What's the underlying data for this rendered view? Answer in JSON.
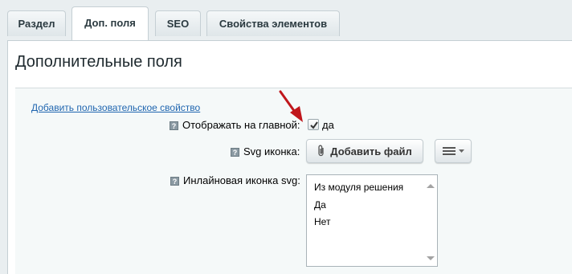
{
  "tabs": [
    {
      "label": "Раздел"
    },
    {
      "label": "Доп. поля"
    },
    {
      "label": "SEO"
    },
    {
      "label": "Свойства элементов"
    }
  ],
  "section_title": "Дополнительные поля",
  "add_property_link": "Добавить пользовательское свойство",
  "fields": {
    "show_on_main": {
      "hint": "?",
      "label": "Отображать на главной:",
      "checkbox_label": "да",
      "checked": true
    },
    "svg_icon": {
      "hint": "?",
      "label": "Svg иконка:",
      "button_label": "Добавить файл"
    },
    "inline_svg": {
      "hint": "?",
      "label": "Инлайновая иконка svg:",
      "options": [
        "Из модуля решения",
        "Да",
        "Нет"
      ]
    }
  },
  "icons": {
    "hint": "question-hint-icon",
    "attach": "paperclip-icon",
    "menu": "hamburger-menu-icon",
    "annotation": "red-arrow-annotation"
  },
  "colors": {
    "link": "#2066b0",
    "annotation_arrow": "#c0171c",
    "background": "#e9eef0"
  }
}
